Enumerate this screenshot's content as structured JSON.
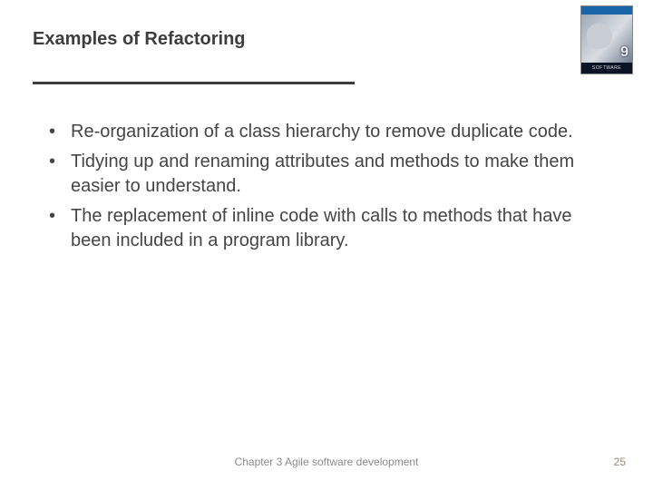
{
  "title": "Examples of Refactoring",
  "cover": {
    "label": "SOFTWARE ENGINEERING",
    "edition": "9"
  },
  "bullets": [
    "Re-organization of a class hierarchy to remove duplicate code.",
    "Tidying up and renaming attributes and methods to make them easier to understand.",
    "The replacement of inline code with calls to methods that have been included in a program library."
  ],
  "footer": {
    "center": "Chapter 3 Agile software development",
    "page": "25"
  }
}
